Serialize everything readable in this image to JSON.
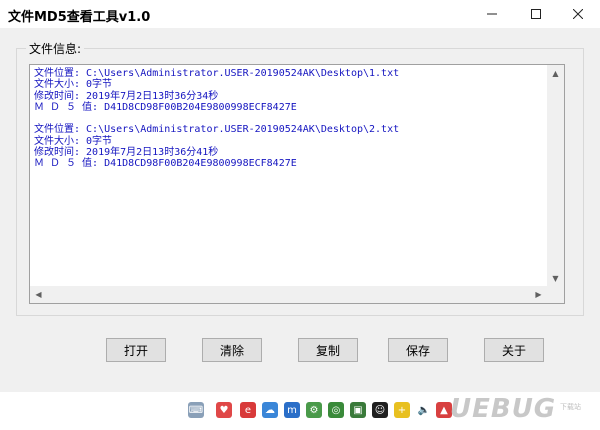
{
  "window": {
    "title": "文件MD5查看工具v1.0",
    "minimize_icon": "minimize-icon",
    "maximize_icon": "maximize-icon",
    "close_icon": "close-icon"
  },
  "file_info": {
    "group_label": "文件信息:",
    "text": "文件位置: C:\\Users\\Administrator.USER-20190524AK\\Desktop\\1.txt\n文件大小: 0字节\n修改时间: 2019年7月2日13时36分34秒\nＭ Ｄ ５ 值: D41D8CD98F00B204E9800998ECF8427E\n\n文件位置: C:\\Users\\Administrator.USER-20190524AK\\Desktop\\2.txt\n文件大小: 0字节\n修改时间: 2019年7月2日13时36分41秒\nＭ Ｄ ５ 值: D41D8CD98F00B204E9800998ECF8427E"
  },
  "buttons": {
    "open": "打开",
    "clear": "清除",
    "copy": "复制",
    "save": "保存",
    "about": "关于"
  },
  "watermark": {
    "brand": "UEBUG",
    "sub": "下载站"
  },
  "colors": {
    "text_blue": "#1515c0",
    "background": "#f0f0f0"
  }
}
